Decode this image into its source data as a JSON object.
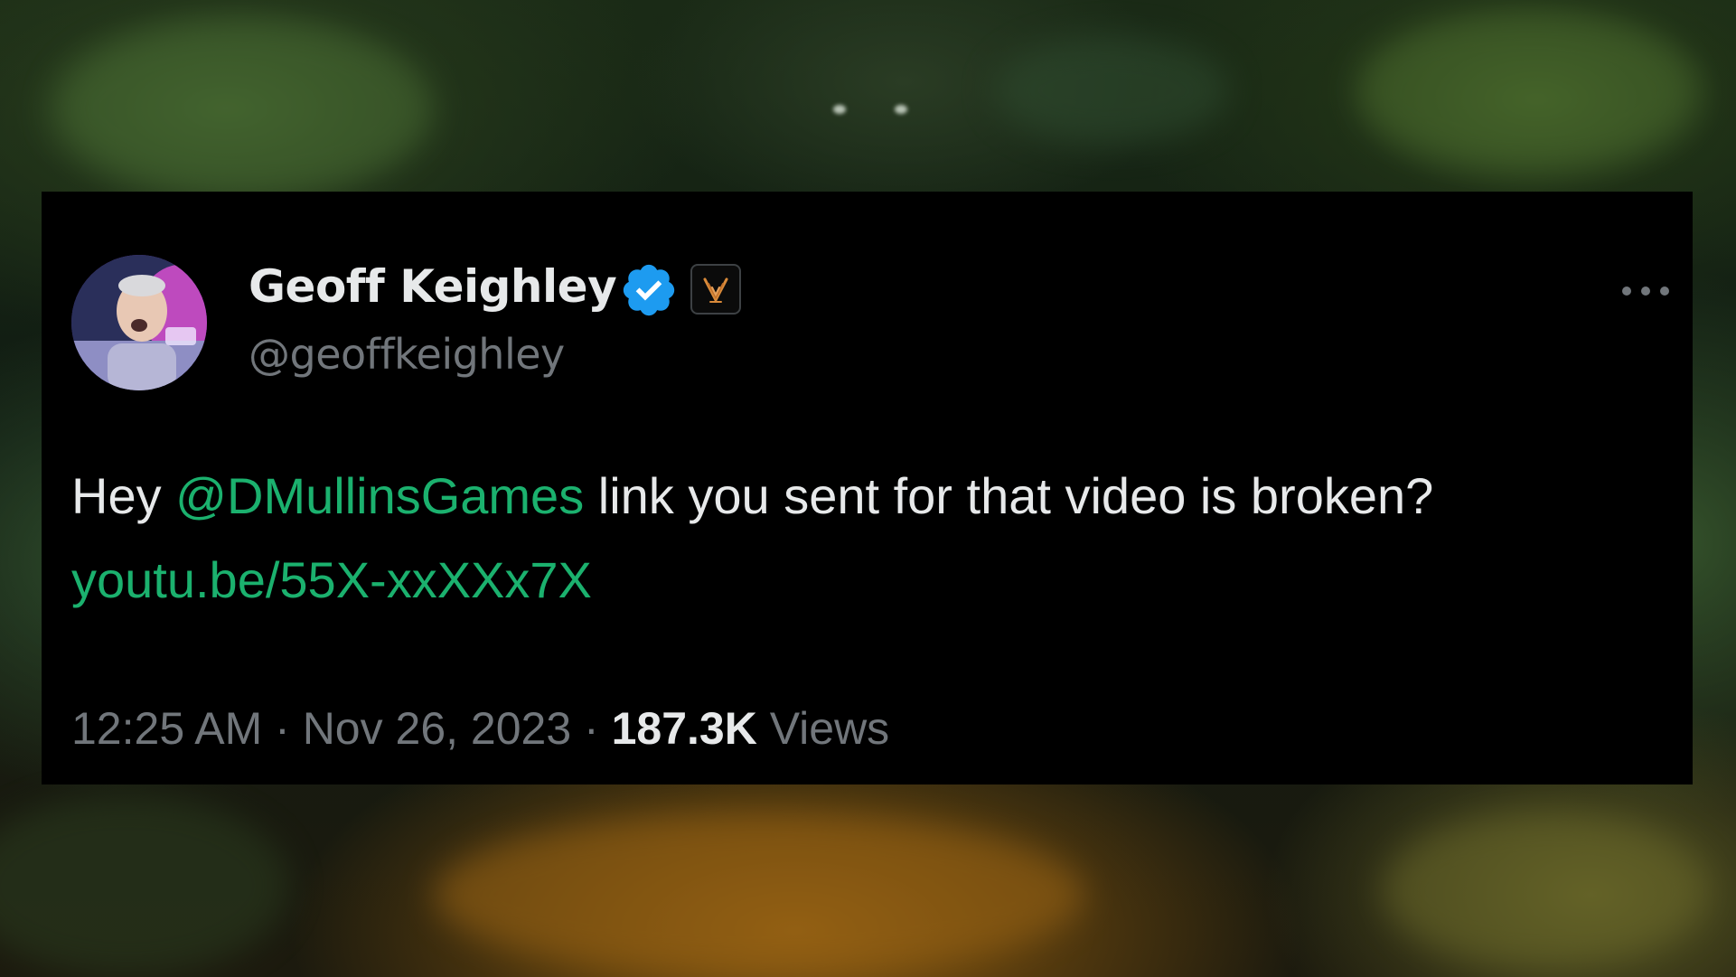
{
  "tweet": {
    "author": {
      "display_name": "Geoff Keighley",
      "handle": "@geoffkeighley",
      "verified_icon": "verified-badge-icon",
      "affiliate_icon": "game-awards-badge-icon"
    },
    "text": {
      "prefix": "Hey ",
      "mention": "@DMullinsGames",
      "body": " link you sent for that video is broken?",
      "link": "youtu.be/55X-xxXXx7X"
    },
    "meta": {
      "time": "12:25 AM",
      "separator_1": " · ",
      "date": "Nov 26, 2023",
      "separator_2": " · ",
      "views_count": "187.3K",
      "views_label": " Views"
    },
    "more_icon": "more-options-icon"
  },
  "colors": {
    "card_background": "#000000",
    "primary_text": "#e7e9ea",
    "secondary_text": "#71767b",
    "link": "#1bb16e",
    "verified_blue": "#1d9bf0"
  }
}
